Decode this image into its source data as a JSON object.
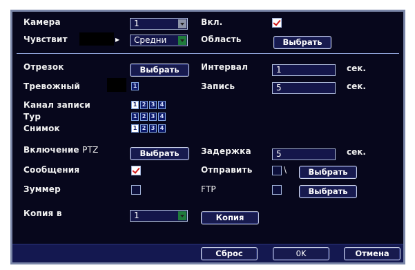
{
  "camera": {
    "label": "Камера",
    "value": "1"
  },
  "enable": {
    "label": "Вкл.",
    "checked": true
  },
  "sensitivity": {
    "label": "Чувствит",
    "value": "Средни"
  },
  "region": {
    "label": "Область",
    "button": "Выбрать"
  },
  "period": {
    "label": "Отрезок",
    "button": "Выбрать"
  },
  "interval": {
    "label": "Интервал",
    "value": "1",
    "unit": "сек."
  },
  "alarm_out": {
    "label": "Тревожный",
    "value": "1"
  },
  "record": {
    "label": "Запись",
    "value": "5",
    "unit": "сек."
  },
  "record_channel": {
    "label": "Канал записи",
    "cells": [
      "1",
      "2",
      "3",
      "4"
    ]
  },
  "tour": {
    "label": "Тур",
    "cells": [
      "1",
      "2",
      "3",
      "4"
    ]
  },
  "snapshot": {
    "label": "Снимок",
    "cells": [
      "1",
      "2",
      "3",
      "4"
    ]
  },
  "ptz": {
    "label_main": "Включение",
    "label_suffix": "PTZ",
    "button": "Выбрать"
  },
  "delay": {
    "label": "Задержка",
    "value": "5",
    "unit": "сек."
  },
  "messages": {
    "label": "Сообщения",
    "checked": true
  },
  "send": {
    "label": "Отправить",
    "suffix": "\\",
    "button": "Выбрать"
  },
  "buzzer": {
    "label": "Зуммер",
    "checked": false
  },
  "ftp": {
    "label": "FTP",
    "button": "Выбрать"
  },
  "copy_to": {
    "label": "Копия в",
    "value": "1",
    "button": "Копия"
  },
  "footer": {
    "reset": "Сброс",
    "ok": "0K",
    "cancel": "Отмена"
  },
  "colors": {
    "panel_bg": "#07071c",
    "field_bg": "#14164a",
    "border": "#a9b6d6",
    "check_mark": "#d01818"
  }
}
